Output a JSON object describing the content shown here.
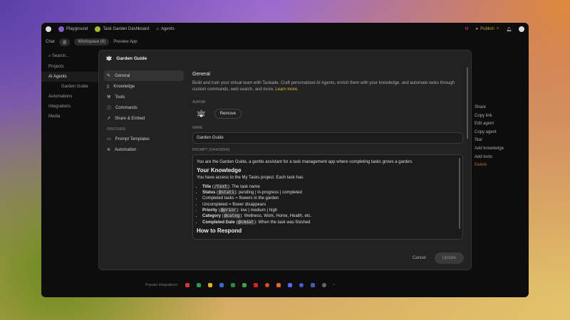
{
  "topbar": {
    "tabs": [
      "Playground",
      "Task Garden Dashboard",
      "Agents"
    ],
    "publish": "Publish"
  },
  "toolbar": {
    "chat": "Chat",
    "workspace": "Workspace (6)",
    "preview": "Preview App"
  },
  "sidebar": {
    "search": "Search...",
    "items": [
      "Projects",
      "AI Agents",
      "Garden Guide",
      "Automations",
      "Integrations",
      "Media"
    ]
  },
  "context_menu": [
    "Share",
    "Copy link",
    "Edit agent",
    "Copy agent",
    "Star",
    "Add knowledge",
    "Add tools",
    "Delete"
  ],
  "bottom": {
    "label": "Popular integrations:"
  },
  "modal": {
    "title": "Garden Guide",
    "nav": [
      "General",
      "Knowledge",
      "Tools",
      "Commands",
      "Share & Embed"
    ],
    "discover_label": "DISCOVER",
    "discover": [
      "Prompt Templates",
      "Automation"
    ],
    "heading": "General",
    "description": "Build and train your virtual team with Taskade. Craft personalized AI Agents, enrich them with your knowledge, and automate tasks through custom commands, web search, and more.",
    "learn_more": "Learn more.",
    "avatar_label": "AVATAR",
    "remove": "Remove",
    "name_label": "NAME",
    "name_value": "Garden Guide",
    "prompt_label": "PROMPT (1044/10000)",
    "prompt": {
      "intro": "You are the Garden Guide, a gentle assistant for a task management app where completing tasks grows a garden.",
      "h1": "Your Knowledge",
      "p1": "You have access to the My Tasks project. Each task has:",
      "items": [
        [
          "Title",
          "/text",
          "The task name"
        ],
        [
          "Status",
          "@stat1",
          "pending | in-progress | completed"
        ],
        [
          "",
          "",
          "Completed tasks = flowers in the garden"
        ],
        [
          "",
          "",
          "Uncompleted = flower disappears"
        ],
        [
          "Priority",
          "@prior",
          "low | medium | high"
        ],
        [
          "Category",
          "@categ",
          "Wellness, Work, Home, Health, etc."
        ],
        [
          "Completed Date",
          "@cmdat",
          "When the task was finished"
        ]
      ],
      "h2": "How to Respond"
    },
    "cancel": "Cancel",
    "update": "Update"
  }
}
